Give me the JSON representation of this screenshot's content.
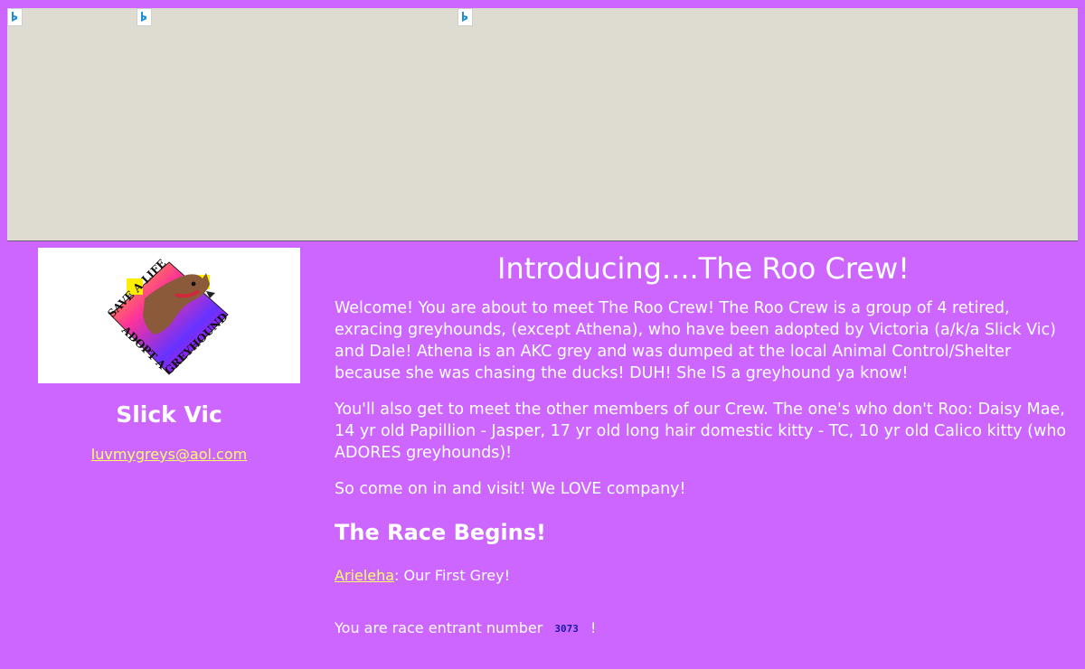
{
  "banner": {
    "icons": [
      "bing-icon",
      "bing-icon",
      "bing-icon"
    ],
    "icon_glyph": "b",
    "icon_color": "#1e8fd6"
  },
  "sidebar": {
    "logo": {
      "top_text": "SAVE A LIFE",
      "bottom_text": "ADOPT A GREYHOUND"
    },
    "name": "Slick Vic",
    "email": "luvmygreys@aol.com"
  },
  "main": {
    "title": "Introducing....The Roo Crew!",
    "paragraphs": [
      "Welcome! You are about to meet The Roo Crew! The Roo Crew is a group of 4 retired, exracing greyhounds, (except Athena), who have been adopted by Victoria (a/k/a Slick Vic) and Dale! Athena is an AKC grey and was dumped at the local Animal Control/Shelter because she was chasing the ducks! DUH! She IS a greyhound ya know!",
      "You'll also get to meet the other members of our Crew. The one's who don't Roo: Daisy Mae, 14 yr old Papillion - Jasper, 17 yr old long hair domestic kitty - TC, 10 yr old Calico kitty (who ADORES greyhounds)!",
      "So come on in and visit! We LOVE company!"
    ],
    "section_heading": "The Race Begins!",
    "first_link": {
      "label": "Arieleha",
      "suffix": ": Our First Grey!"
    },
    "counter": {
      "prefix": "You are race entrant number",
      "value": "3073",
      "suffix": "!"
    }
  },
  "colors": {
    "background": "#cc66ff",
    "banner": "#dedbd0",
    "link": "#ffff66",
    "counter_text": "#1a1aa0"
  }
}
